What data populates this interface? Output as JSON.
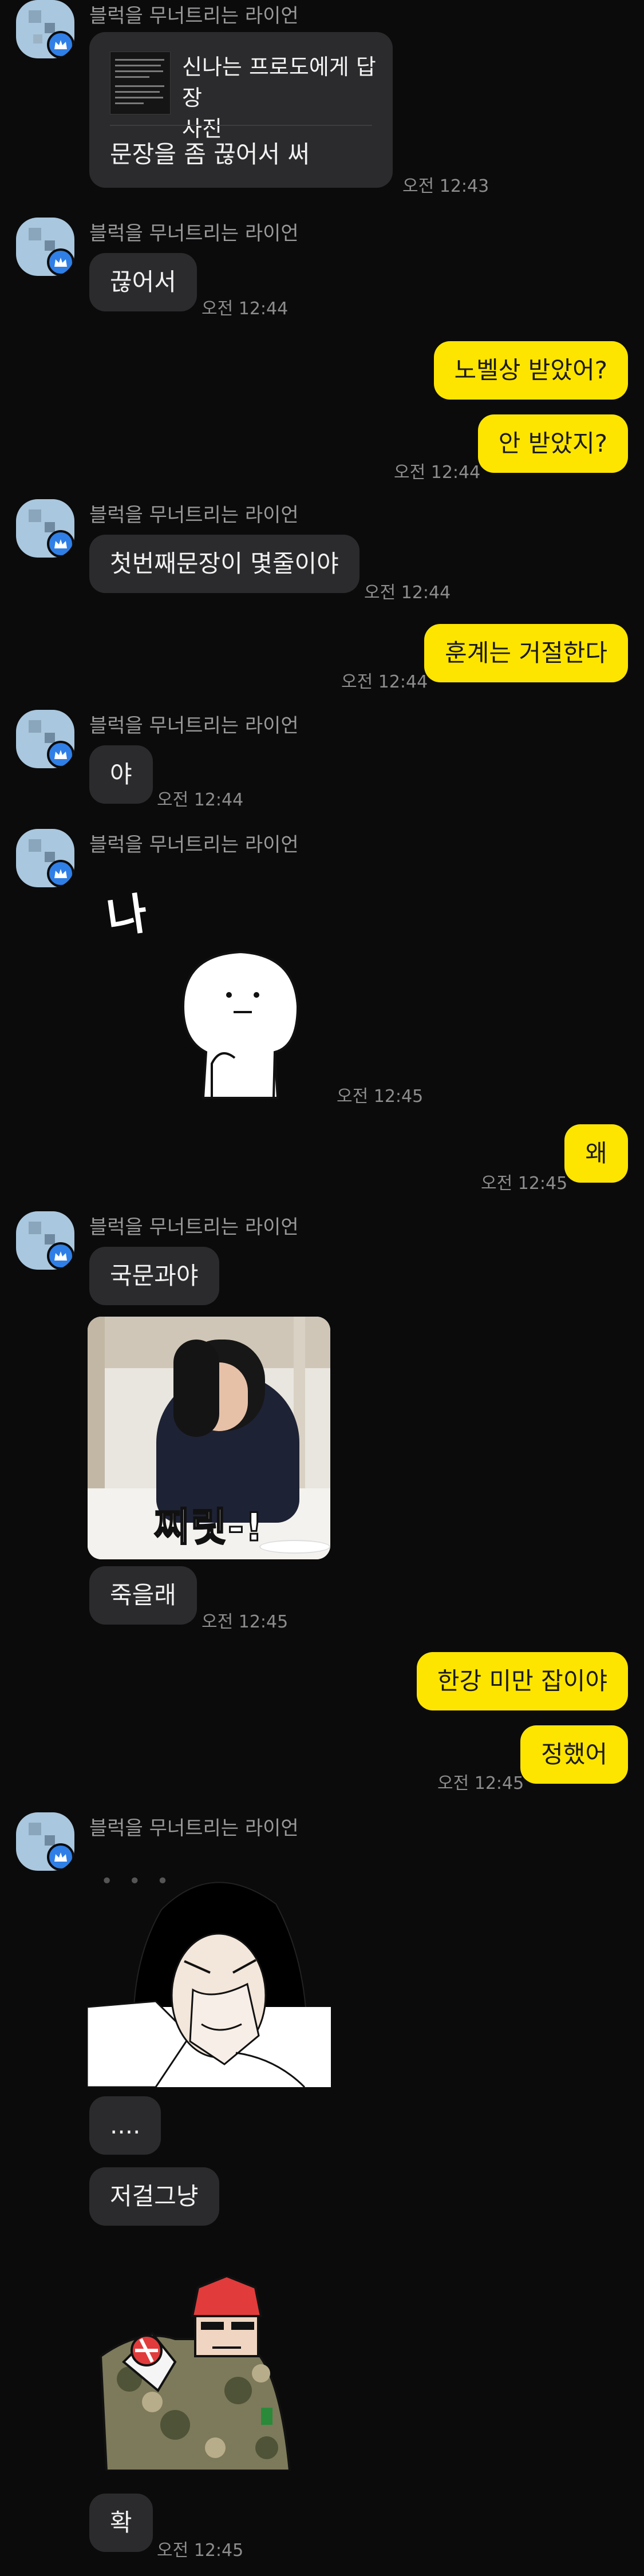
{
  "sender_name": "블럭을 무너트리는 라이언",
  "messages": {
    "m1": {
      "reply_title": "신나는 프로도에게 답장",
      "reply_sub": "사진",
      "text": "문장을 좀 끊어서 써",
      "time": "오전 12:43"
    },
    "m2": {
      "text": "끊어서",
      "time": "오전 12:44"
    },
    "m3": {
      "text": "노벨상 받았어?"
    },
    "m4": {
      "text": "안 받았지?",
      "time": "오전 12:44"
    },
    "m5": {
      "text": "첫번째문장이 몇줄이야",
      "time": "오전 12:44"
    },
    "m6": {
      "text": "훈계는 거절한다",
      "time": "오전 12:44"
    },
    "m7": {
      "text": "야",
      "time": "오전 12:44"
    },
    "m8": {
      "sticker_caption": "나",
      "time": "오전 12:45"
    },
    "m9": {
      "text": "왜",
      "time": "오전 12:45"
    },
    "m10": {
      "text": "국문과야",
      "photo_caption": "찌릿-!",
      "text2": "죽을래",
      "time": "오전 12:45"
    },
    "m11": {
      "text": "한강 미만 잡이야"
    },
    "m12": {
      "text": "정했어",
      "time": "오전 12:45"
    },
    "m13": {
      "sticker_caption": "• • •",
      "text": "....",
      "text2": "저걸그냥",
      "text3": "확",
      "time": "오전 12:45"
    }
  }
}
